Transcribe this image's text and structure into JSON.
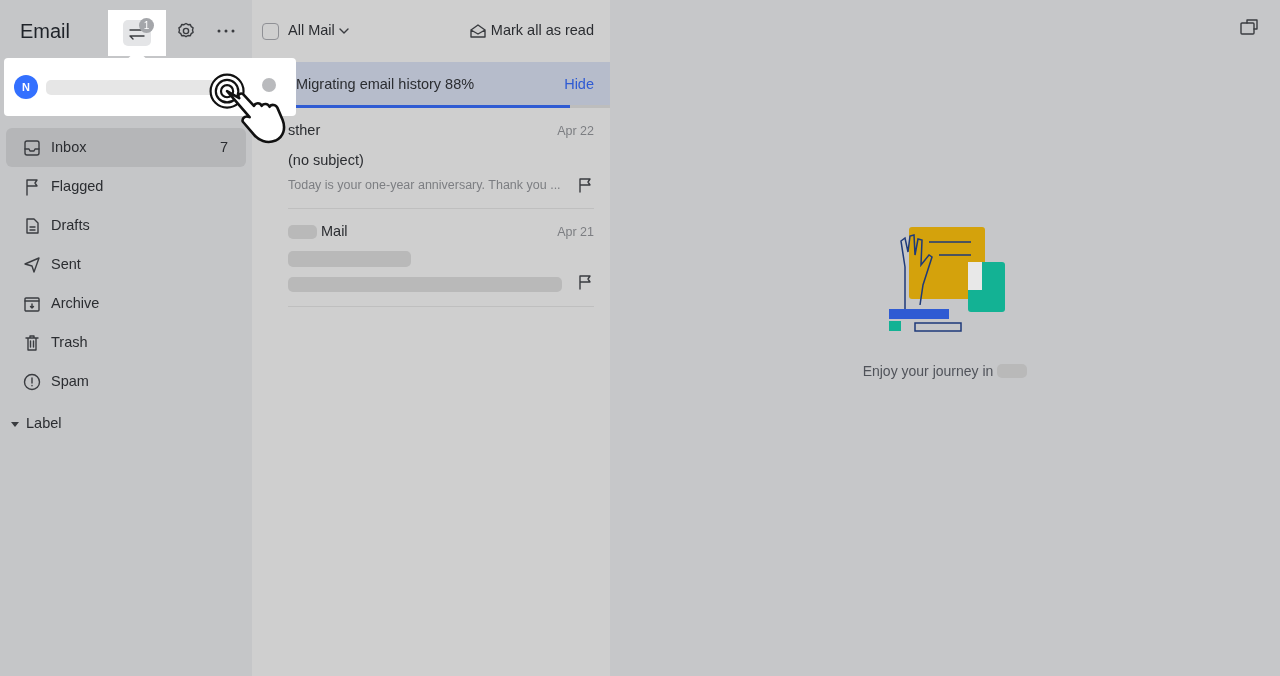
{
  "app": {
    "title": "Email",
    "switch_badge": "1"
  },
  "account_popup": {
    "avatar": "N"
  },
  "sidebar": {
    "items": [
      {
        "kind": "inbox",
        "label": "Inbox",
        "count": "7",
        "selected": true
      },
      {
        "kind": "flag",
        "label": "Flagged",
        "selected": false
      },
      {
        "kind": "draft",
        "label": "Drafts",
        "selected": false
      },
      {
        "kind": "sent",
        "label": "Sent",
        "selected": false
      },
      {
        "kind": "archive",
        "label": "Archive",
        "selected": false
      },
      {
        "kind": "trash",
        "label": "Trash",
        "selected": false
      },
      {
        "kind": "spam",
        "label": "Spam",
        "selected": false
      }
    ],
    "label_section": {
      "label": "Label",
      "expanded": true
    }
  },
  "list_header": {
    "select_all_checked": false,
    "filter": "All Mail",
    "mark_read": "Mark all as read"
  },
  "migration": {
    "text": "Migrating email history 88%",
    "action": "Hide",
    "level": 0.88
  },
  "messages": [
    {
      "sender": "sther",
      "date": "Apr 22",
      "subject": "(no subject)",
      "preview": "Today is your one-year anniversary. Thank you ..."
    },
    {
      "sender": "Mail",
      "sender_redacted": true,
      "date": "Apr 21"
    }
  ],
  "empty_state": {
    "text": "Enjoy your journey in"
  }
}
